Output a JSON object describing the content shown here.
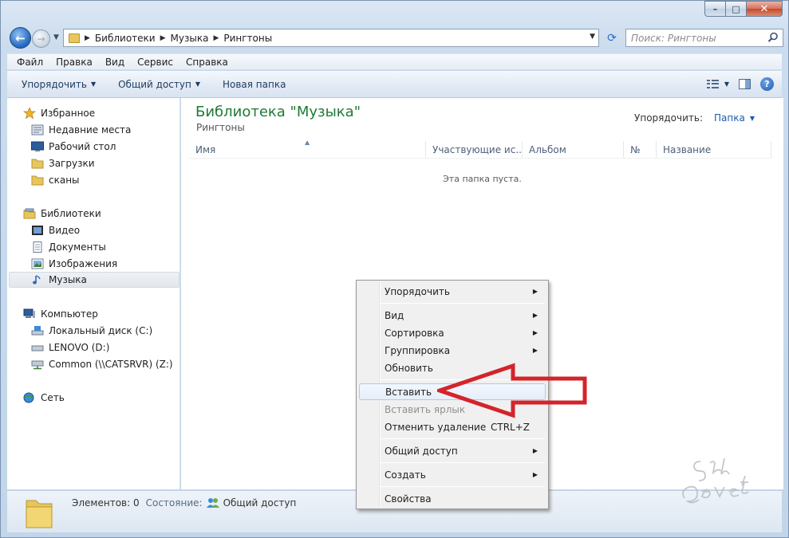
{
  "address": {
    "crumbs": [
      "Библиотеки",
      "Музыка",
      "Рингтоны"
    ],
    "search_placeholder": "Поиск: Рингтоны"
  },
  "menubar": {
    "items": [
      "Файл",
      "Правка",
      "Вид",
      "Сервис",
      "Справка"
    ]
  },
  "toolbar": {
    "organize": "Упорядочить",
    "share": "Общий доступ",
    "new_folder": "Новая папка"
  },
  "navpane": {
    "favorites": "Избранное",
    "recent": "Недавние места",
    "desktop": "Рабочий стол",
    "downloads": "Загрузки",
    "scans": "сканы",
    "libraries": "Библиотеки",
    "video": "Видео",
    "documents": "Документы",
    "images": "Изображения",
    "music": "Музыка",
    "computer": "Компьютер",
    "local_disk": "Локальный диск (C:)",
    "lenovo": "LENOVO (D:)",
    "common": "Common (\\\\CATSRVR) (Z:)",
    "network": "Сеть"
  },
  "content": {
    "title": "Библиотека \"Музыка\"",
    "subtitle": "Рингтоны",
    "arrange_label": "Упорядочить:",
    "arrange_value": "Папка",
    "columns": [
      "Имя",
      "Участвующие ис...",
      "Альбом",
      "№",
      "Название"
    ],
    "empty": "Эта папка пуста."
  },
  "status": {
    "count": "Элементов: 0",
    "state_label": "Состояние:",
    "state_value": "Общий доступ"
  },
  "context_menu": {
    "arrange": "Упорядочить",
    "view": "Вид",
    "sort": "Сортировка",
    "group": "Группировка",
    "refresh": "Обновить",
    "paste": "Вставить",
    "paste_shortcut": "Вставить ярлык",
    "undo_delete": "Отменить удаление",
    "undo_shortcut": "CTRL+Z",
    "share": "Общий доступ",
    "create": "Создать",
    "properties": "Свойства"
  },
  "colors": {
    "title_green": "#1e7a35",
    "accent_blue": "#1e5ba8",
    "annotation_red": "#d4242b"
  }
}
